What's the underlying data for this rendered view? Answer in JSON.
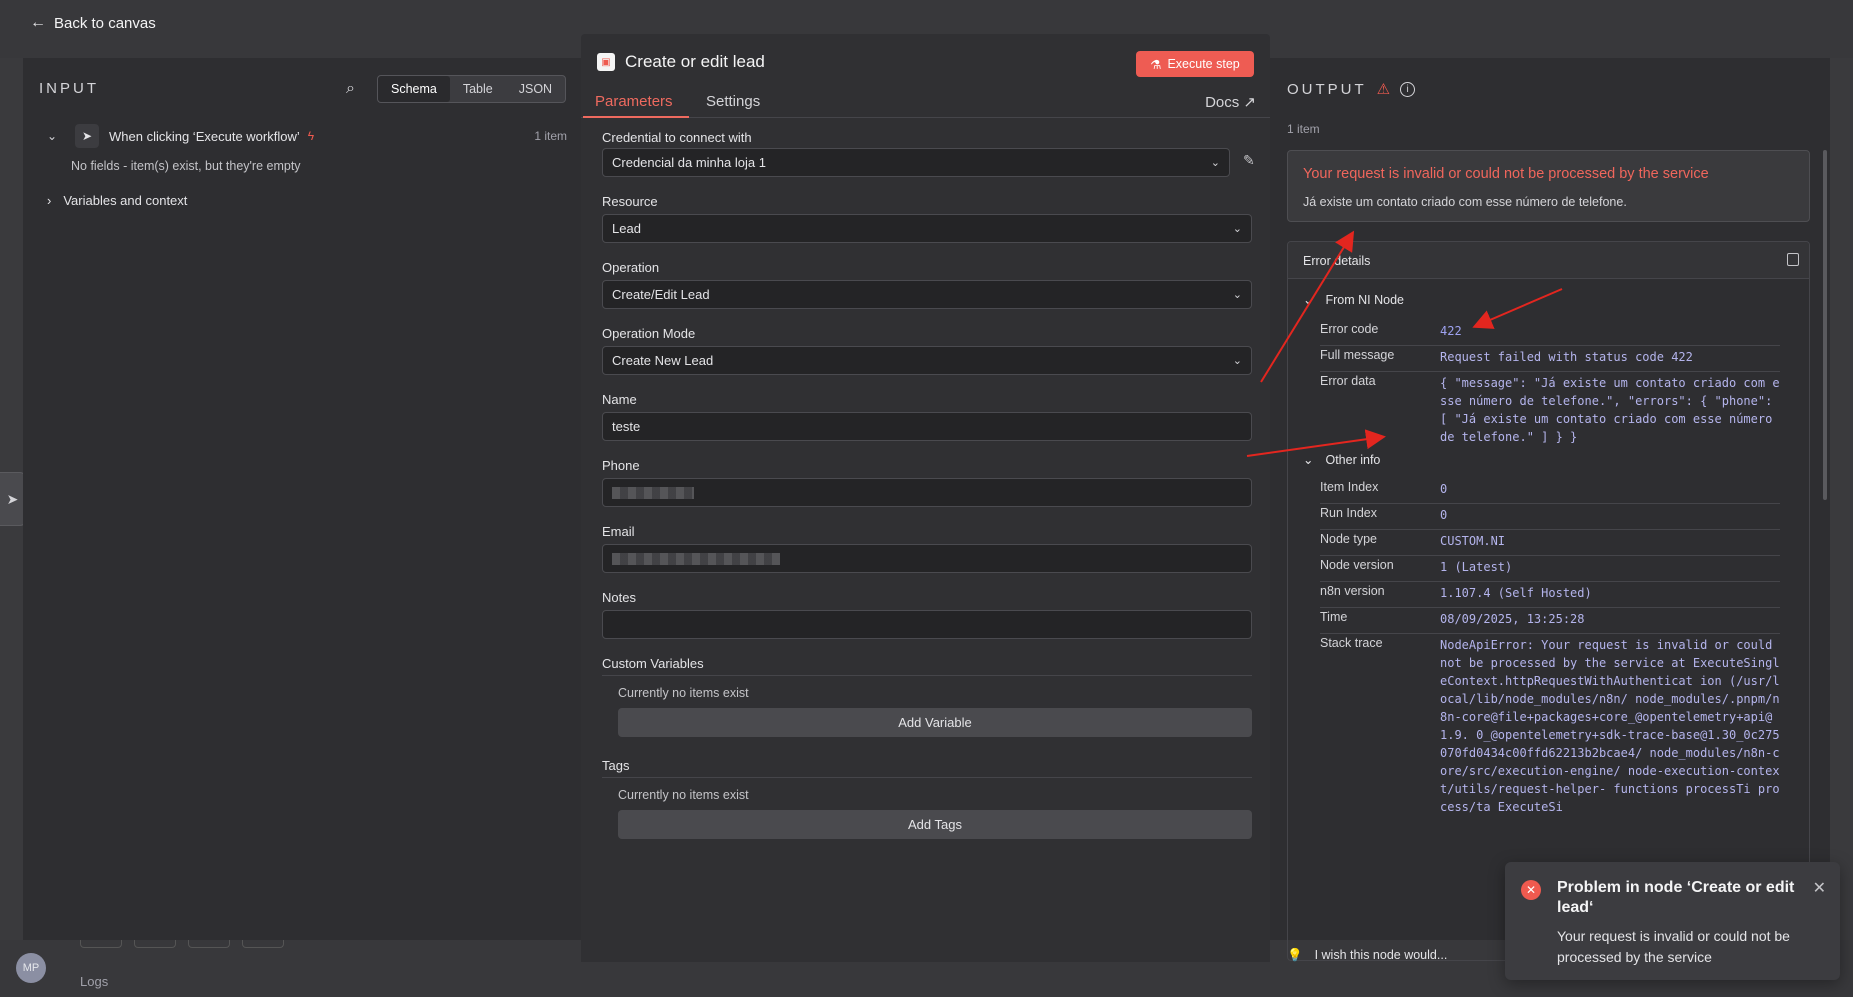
{
  "header": {
    "back_label": "Back to canvas"
  },
  "footer": {
    "logs_label": "Logs",
    "avatar_initials": "MP"
  },
  "input": {
    "title": "INPUT",
    "view_tabs": [
      "Schema",
      "Table",
      "JSON"
    ],
    "trigger_label": "When clicking ‘Execute workflow’",
    "trigger_count": "1 item",
    "empty_message": "No fields - item(s) exist, but they're empty",
    "variables_label": "Variables and context"
  },
  "node": {
    "title": "Create or edit lead",
    "execute_label": "Execute step",
    "tabs": {
      "parameters": "Parameters",
      "settings": "Settings",
      "docs": "Docs"
    },
    "fields": {
      "credential": {
        "label": "Credential to connect with",
        "value": "Credencial da minha loja 1"
      },
      "resource": {
        "label": "Resource",
        "value": "Lead"
      },
      "operation": {
        "label": "Operation",
        "value": "Create/Edit Lead"
      },
      "operation_mode": {
        "label": "Operation Mode",
        "value": "Create New Lead"
      },
      "name": {
        "label": "Name",
        "value": "teste"
      },
      "phone": {
        "label": "Phone"
      },
      "email": {
        "label": "Email"
      },
      "notes": {
        "label": "Notes",
        "value": ""
      }
    },
    "custom_variables": {
      "title": "Custom Variables",
      "empty": "Currently no items exist",
      "button": "Add Variable"
    },
    "tags": {
      "title": "Tags",
      "empty": "Currently no items exist",
      "button": "Add Tags"
    }
  },
  "output": {
    "title": "OUTPUT",
    "count": "1 item",
    "error_title": "Your request is invalid or could not be processed by the service",
    "error_description": "Já existe um contato criado com esse número de telefone.",
    "details_title": "Error details",
    "from_node": "From NI Node",
    "error_code_label": "Error code",
    "error_code": "422",
    "full_message_label": "Full message",
    "full_message": "Request failed with status code 422",
    "error_data_label": "Error data",
    "error_data": "{ \"message\": \"Já existe um contato criado com esse número de telefone.\", \"errors\": { \"phone\": [ \"Já existe um contato criado com esse número de telefone.\" ] } }",
    "other_info": "Other info",
    "info": [
      {
        "key": "Item Index",
        "value": "0"
      },
      {
        "key": "Run Index",
        "value": "0"
      },
      {
        "key": "Node type",
        "value": "CUSTOM.NI"
      },
      {
        "key": "Node version",
        "value": "1 (Latest)"
      },
      {
        "key": "n8n version",
        "value": "1.107.4 (Self Hosted)"
      },
      {
        "key": "Time",
        "value": "08/09/2025, 13:25:28"
      }
    ],
    "stack_trace_label": "Stack trace",
    "stack_trace": "NodeApiError: Your request is invalid or could not be processed by the service at ExecuteSingleContext.httpRequestWithAuthenticat ion (/usr/local/lib/node_modules/n8n/ node_modules/.pnpm/n8n-core@file+packages+core_@opentelemetry+api@1.9. 0_@opentelemetry+sdk-trace-base@1.30_0c275070fd0434c00ffd62213b2bcae4/ node_modules/n8n-core/src/execution-engine/ node-execution-context/utils/request-helper- functions processTi process/ta ExecuteSi",
    "wish_label": "I wish this node would..."
  },
  "toast": {
    "title": "Problem in node ‘Create or edit lead‘",
    "message": "Your request is invalid or could not be processed by the service"
  },
  "colors": {
    "accent": "#ee5c53",
    "error": "#f0665c",
    "mono_value": "#b4b4ec"
  }
}
